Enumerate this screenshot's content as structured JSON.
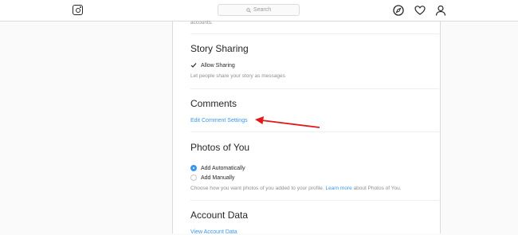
{
  "header": {
    "search_placeholder": "Search"
  },
  "settings": {
    "top_fragment": "accounts.",
    "story_sharing": {
      "title": "Story Sharing",
      "checkbox_label": "Allow Sharing",
      "checkbox_checked": true,
      "help": "Let people share your story as messages"
    },
    "comments": {
      "title": "Comments",
      "link": "Edit Comment Settings"
    },
    "photos_of_you": {
      "title": "Photos of You",
      "options": [
        {
          "label": "Add Automatically",
          "selected": true
        },
        {
          "label": "Add Manually",
          "selected": false
        }
      ],
      "help_before": "Choose how you want photos of you added to your profile. ",
      "help_link": "Learn more",
      "help_after": " about Photos of You."
    },
    "account_data": {
      "title": "Account Data",
      "link": "View Account Data"
    }
  },
  "colors": {
    "link": "#3897f0",
    "annotation_arrow": "#e0191b"
  }
}
